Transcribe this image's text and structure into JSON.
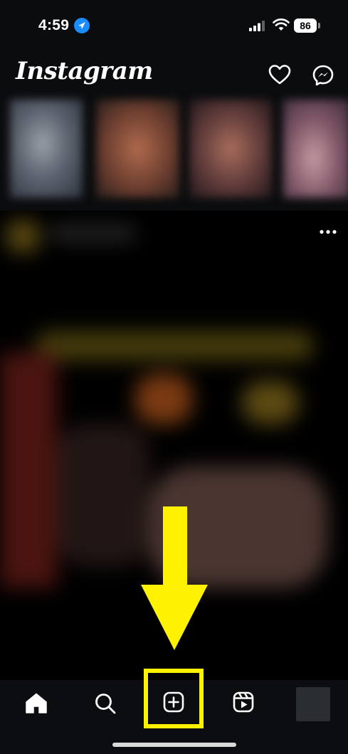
{
  "status_bar": {
    "time": "4:59",
    "battery": "86"
  },
  "header": {
    "logo": "Instagram"
  },
  "icons": {
    "location": "location-arrow-icon",
    "signal": "cellular-signal-icon",
    "wifi": "wifi-icon",
    "heart": "heart-icon",
    "messenger": "messenger-icon",
    "more": "more-horizontal-icon",
    "home": "home-icon",
    "search": "search-icon",
    "create": "create-post-icon",
    "reels": "reels-icon"
  },
  "colors": {
    "background": "#0a0c0e",
    "highlight": "#fff200",
    "location_blue": "#1a8cff"
  }
}
